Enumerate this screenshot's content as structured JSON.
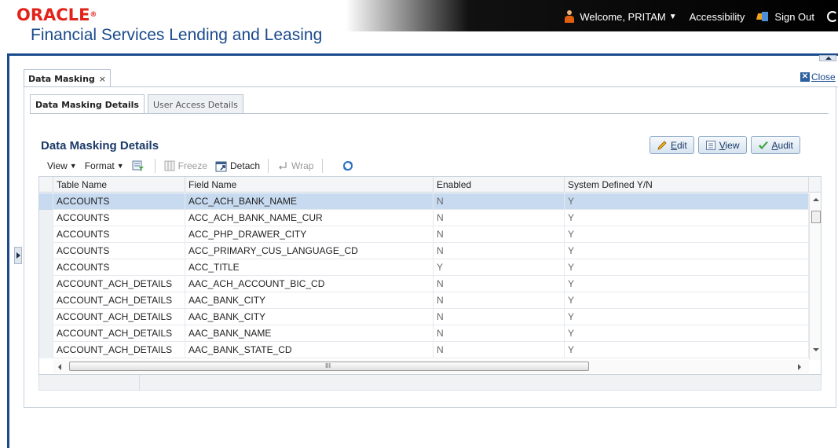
{
  "header": {
    "logo_text": "ORACLE",
    "logo_mark": "®",
    "product_name": "Financial Services Lending and Leasing",
    "welcome": "Welcome, PRITAM",
    "accessibility": "Accessibility",
    "sign_out": "Sign Out"
  },
  "page_tab": {
    "label": "Data Masking",
    "close_glyph": "×"
  },
  "close_link": {
    "label": "Close"
  },
  "subtabs": [
    {
      "label": "Data Masking Details",
      "active": true
    },
    {
      "label": "User Access Details",
      "active": false
    }
  ],
  "section_title": "Data Masking Details",
  "actions": {
    "edit_first": "E",
    "edit_rest": "dit",
    "view_first": "V",
    "view_rest": "iew",
    "audit_first": "A",
    "audit_rest": "udit"
  },
  "toolbar": {
    "view": "View",
    "format": "Format",
    "freeze": "Freeze",
    "detach": "Detach",
    "wrap": "Wrap"
  },
  "table": {
    "columns": [
      "Table Name",
      "Field Name",
      "Enabled",
      "System Defined Y/N"
    ],
    "rows": [
      [
        "ACCOUNTS",
        "ACC_ACH_BANK_NAME",
        "N",
        "Y"
      ],
      [
        "ACCOUNTS",
        "ACC_ACH_BANK_NAME_CUR",
        "N",
        "Y"
      ],
      [
        "ACCOUNTS",
        "ACC_PHP_DRAWER_CITY",
        "N",
        "Y"
      ],
      [
        "ACCOUNTS",
        "ACC_PRIMARY_CUS_LANGUAGE_CD",
        "N",
        "Y"
      ],
      [
        "ACCOUNTS",
        "ACC_TITLE",
        "Y",
        "Y"
      ],
      [
        "ACCOUNT_ACH_DETAILS",
        "AAC_ACH_ACCOUNT_BIC_CD",
        "N",
        "Y"
      ],
      [
        "ACCOUNT_ACH_DETAILS",
        "AAC_BANK_CITY",
        "N",
        "Y"
      ],
      [
        "ACCOUNT_ACH_DETAILS",
        "AAC_BANK_CITY",
        "N",
        "Y"
      ],
      [
        "ACCOUNT_ACH_DETAILS",
        "AAC_BANK_NAME",
        "N",
        "Y"
      ],
      [
        "ACCOUNT_ACH_DETAILS",
        "AAC_BANK_STATE_CD",
        "N",
        "Y"
      ]
    ],
    "selected_row": 0,
    "hscroll_grip": "III"
  },
  "colors": {
    "brand_red": "#e2231a",
    "brand_blue": "#1b4a8c",
    "selected_row": "#c7daf0"
  }
}
